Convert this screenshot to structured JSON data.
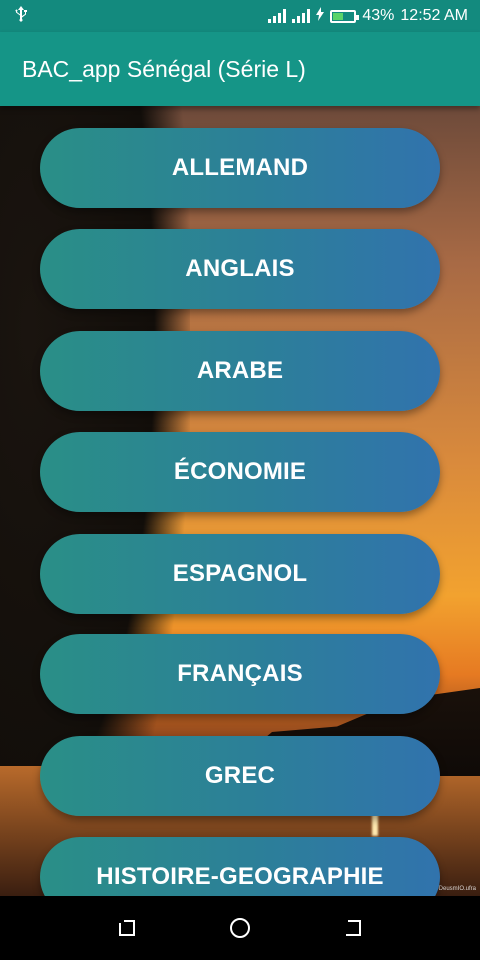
{
  "status_bar": {
    "battery_text": "43%",
    "time": "12:52 AM",
    "usb_icon": "usb-icon",
    "battery_level": 0.43,
    "battery_color": "#5bd36a"
  },
  "app_bar": {
    "title": "BAC_app Sénégal (Série L)",
    "color": "#159587"
  },
  "subjects": [
    {
      "label": "ALLEMAND"
    },
    {
      "label": "ANGLAIS"
    },
    {
      "label": "ARABE"
    },
    {
      "label": "ÉCONOMIE"
    },
    {
      "label": "ESPAGNOL"
    },
    {
      "label": "FRANÇAIS"
    },
    {
      "label": "GREC"
    },
    {
      "label": "HISTOIRE-GEOGRAPHIE"
    }
  ],
  "watermark": "©DeusmIO.ufra",
  "nav_bar": {
    "icons": [
      "recent-apps-icon",
      "home-icon",
      "back-icon"
    ]
  }
}
